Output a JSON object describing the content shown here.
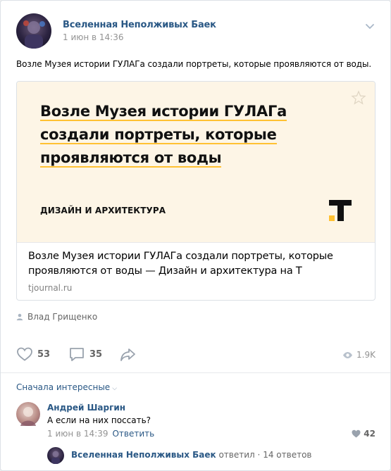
{
  "post": {
    "author": "Вселенная Неполживых Баек",
    "date": "1 июн в 14:36",
    "text": "Возле Музея истории ГУЛАГа создали портреты, которые проявляются от воды.",
    "signer": "Влад Грищенко"
  },
  "snippet": {
    "image_title_lines": [
      "Возле Музея истории ГУЛАГа",
      "создали портреты, которые",
      "проявляются от воды"
    ],
    "image_rubric": "ДИЗАЙН И АРХИТЕКТУРА",
    "title": "Возле Музея истории ГУЛАГа создали портреты, которые проявляются от воды — Дизайн и архитектура на T",
    "domain": "tjournal.ru"
  },
  "actions": {
    "likes": "53",
    "comments": "35",
    "views": "1.9K"
  },
  "comments": {
    "sort_label": "Сначала интересные",
    "items": [
      {
        "author": "Андрей Шаргин",
        "text": "А если на них поссать?",
        "date": "1 июн в 14:39",
        "reply_label": "Ответить",
        "likes": "42"
      }
    ],
    "thread": {
      "author": "Вселенная Неполживых Баек",
      "action": "ответил",
      "separator": "·",
      "count": "14 ответов"
    }
  },
  "colors": {
    "link": "#2a5885",
    "accent_yellow": "#ffc132",
    "snippet_bg": "#fdf5e6"
  }
}
